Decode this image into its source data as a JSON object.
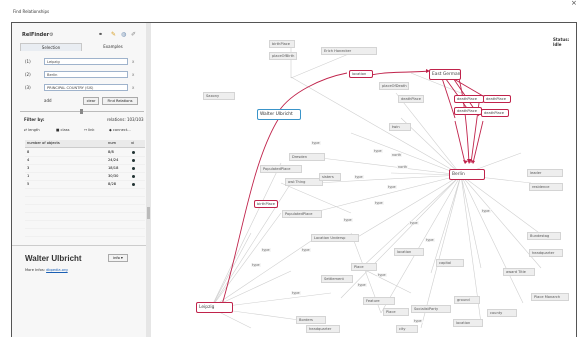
{
  "window": {
    "title": "Find Relationships",
    "close": "×"
  },
  "left_panel": {
    "logo": "RelFinder",
    "tabs": [
      "Selection",
      "Examples"
    ],
    "inputs": [
      {
        "num": "(1)",
        "value": "Leipzig"
      },
      {
        "num": "(2)",
        "value": "Berlin"
      },
      {
        "num": "(3)",
        "value": "PRINCIPAL COUNTRY (SIS)"
      }
    ],
    "remove_glyph": "x",
    "add_label": "add",
    "clear_label": "clear",
    "find_label": "Find Relations",
    "filter_label": "Filter by:",
    "relations_count": "relations: 103/103",
    "filter_tabs": [
      "length",
      "class",
      "link",
      "connect..."
    ],
    "table_headers": [
      "number of objects",
      "num",
      "vi"
    ],
    "table_rows": [
      {
        "n": "8",
        "v": "8/8"
      },
      {
        "n": "4",
        "v": "24/24"
      },
      {
        "n": "3",
        "v": "18/18"
      },
      {
        "n": "1",
        "v": "30/30"
      },
      {
        "n": "5",
        "v": "8/28"
      }
    ],
    "person_name": "Walter Ulbricht",
    "person_button": "info",
    "more_info_label": "More Infos:",
    "more_info_link": "dbpedia.org"
  },
  "graph": {
    "status": "Status: Idle",
    "nodes": [
      {
        "id": "leipzig",
        "label": "Leipzig",
        "style": "red"
      },
      {
        "id": "berlin",
        "label": "Berlin",
        "style": "red"
      },
      {
        "id": "walter",
        "label": "Walter Ulbricht",
        "style": "blue"
      },
      {
        "id": "east",
        "label": "East Germany",
        "style": "red"
      },
      {
        "id": "erich",
        "label": "Erich Honecker",
        "style": "plain"
      },
      {
        "id": "saxony",
        "label": "Saxony",
        "style": "plain"
      },
      {
        "id": "birthplace",
        "label": "birthPlace",
        "style": "red"
      },
      {
        "id": "birthplace2",
        "label": "birthPlace",
        "style": "plain"
      },
      {
        "id": "placeofbirth",
        "label": "placeOfBirth",
        "style": "plain"
      },
      {
        "id": "placeofdeath",
        "label": "placeOfDeath",
        "style": "plain"
      },
      {
        "id": "deathplace",
        "label": "deathPlace",
        "style": "plain"
      },
      {
        "id": "location",
        "label": "location",
        "style": "red"
      },
      {
        "id": "deathPlace1",
        "label": "deathPlace",
        "style": "red"
      },
      {
        "id": "deathPlace2",
        "label": "deathPlace",
        "style": "red"
      },
      {
        "id": "deathPlace3",
        "label": "deathPlace",
        "style": "red"
      },
      {
        "id": "deathPlace4",
        "label": "deathPlace",
        "style": "red"
      },
      {
        "id": "dresden",
        "label": "Dresden",
        "style": "plain"
      },
      {
        "id": "pp1",
        "label": "PopulatedPlace",
        "style": "plain"
      },
      {
        "id": "pp2",
        "label": "PopulatedPlace",
        "style": "plain"
      },
      {
        "id": "owl",
        "label": "owl:Thing",
        "style": "plain"
      },
      {
        "id": "lu",
        "label": "Location Undersp",
        "style": "plain"
      },
      {
        "id": "place",
        "label": "Place",
        "style": "plain"
      },
      {
        "id": "settlement",
        "label": "Settlement",
        "style": "plain"
      },
      {
        "id": "feature",
        "label": "Feature",
        "style": "plain"
      },
      {
        "id": "place2",
        "label": "Place",
        "style": "plain"
      },
      {
        "id": "borders",
        "label": "Borders",
        "style": "plain"
      },
      {
        "id": "headquarter",
        "label": "headquarter",
        "style": "plain"
      },
      {
        "id": "bundestag",
        "label": "Bundestag",
        "style": "plain"
      },
      {
        "id": "placemonarch",
        "label": "Place Monarch",
        "style": "plain"
      },
      {
        "id": "awardtitle",
        "label": "award Title",
        "style": "plain"
      },
      {
        "id": "leader",
        "label": "leader",
        "style": "plain"
      },
      {
        "id": "residence",
        "label": "residence",
        "style": "plain"
      },
      {
        "id": "hqcity",
        "label": "headquarter",
        "style": "plain"
      },
      {
        "id": "capital",
        "label": "capital",
        "style": "plain"
      },
      {
        "id": "locatedin",
        "label": "location",
        "style": "plain"
      },
      {
        "id": "party",
        "label": "SocialistParty",
        "style": "plain"
      },
      {
        "id": "ground",
        "label": "ground",
        "style": "plain"
      },
      {
        "id": "citySF",
        "label": "location",
        "style": "plain"
      },
      {
        "id": "county",
        "label": "county",
        "style": "plain"
      },
      {
        "id": "city2",
        "label": "city",
        "style": "plain"
      },
      {
        "id": "sisters",
        "label": "sisters",
        "style": "plain"
      },
      {
        "id": "lg",
        "label": "twin",
        "style": "plain"
      }
    ],
    "edge_labels": [
      "type",
      "type",
      "type",
      "type",
      "type",
      "type",
      "type",
      "type",
      "type",
      "type",
      "type",
      "type",
      "type",
      "type",
      "north",
      "north",
      "type",
      "type"
    ]
  }
}
